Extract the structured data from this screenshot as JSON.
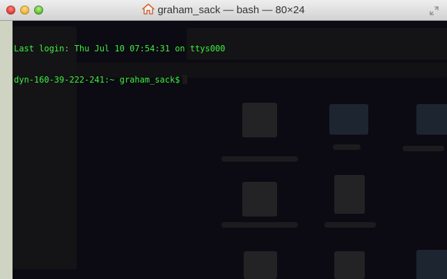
{
  "window": {
    "title": "graham_sack — bash — 80×24",
    "title_icon": "home-icon"
  },
  "terminal": {
    "lines": [
      "Last login: Thu Jul 10 07:54:31 on ttys000",
      "dyn-160-39-222-241:~ graham_sack$"
    ],
    "text_color": "#3df03d",
    "background_color": "#0c0a12"
  },
  "colors": {
    "close": "#e0443e",
    "minimize": "#f0b73c",
    "zoom": "#6ac33e"
  }
}
